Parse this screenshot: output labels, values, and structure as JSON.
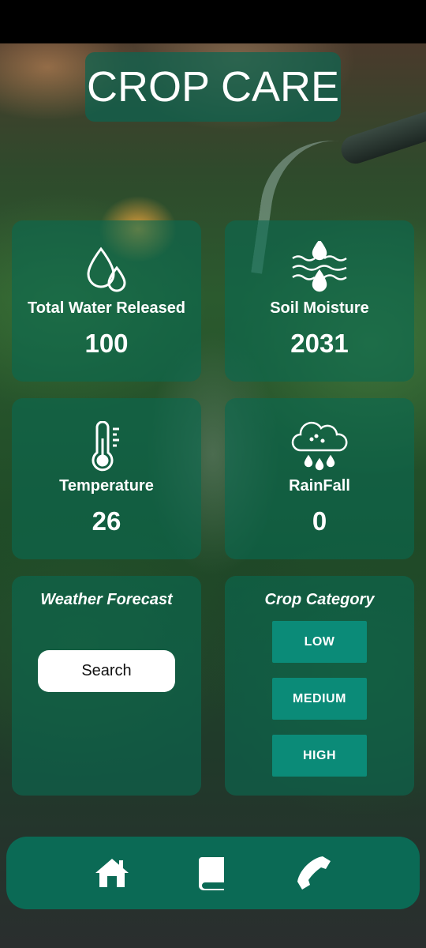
{
  "app": {
    "title": "CROP CARE"
  },
  "stats": [
    {
      "label": "Total Water Released",
      "value": "100",
      "icon": "water-drops-icon"
    },
    {
      "label": "Soil Moisture",
      "value": "2031",
      "icon": "soil-moisture-icon"
    },
    {
      "label": "Temperature",
      "value": "26",
      "icon": "thermometer-icon"
    },
    {
      "label": "RainFall",
      "value": "0",
      "icon": "rain-cloud-icon"
    }
  ],
  "weather_forecast": {
    "title": "Weather Forecast",
    "search_label": "Search"
  },
  "crop_category": {
    "title": "Crop Category",
    "options": [
      "LOW",
      "MEDIUM",
      "HIGH"
    ]
  },
  "nav": {
    "items": [
      "home-icon",
      "book-icon",
      "phone-icon"
    ]
  },
  "colors": {
    "card": "#0a6950",
    "button": "#0b8b78",
    "nav": "#0b6a55"
  }
}
